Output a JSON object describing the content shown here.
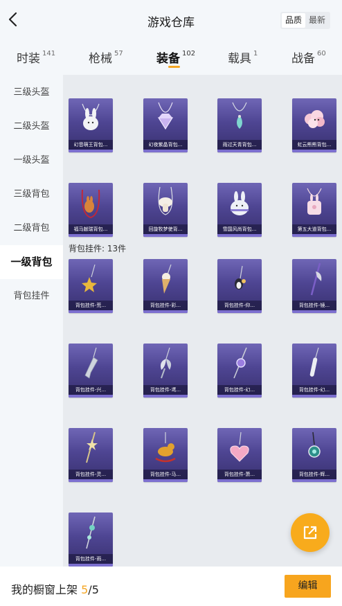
{
  "header": {
    "title": "游戏仓库",
    "sort": {
      "options": [
        "品质",
        "最新"
      ],
      "selected": "品质"
    }
  },
  "tabs": [
    {
      "label": "时装",
      "count": "141"
    },
    {
      "label": "枪械",
      "count": "57"
    },
    {
      "label": "装备",
      "count": "102",
      "active": true
    },
    {
      "label": "载具",
      "count": "1"
    },
    {
      "label": "战备",
      "count": "60"
    }
  ],
  "sidebar": {
    "items": [
      {
        "label": "三级头盔"
      },
      {
        "label": "二级头盔"
      },
      {
        "label": "一级头盔"
      },
      {
        "label": "三级背包"
      },
      {
        "label": "二级背包"
      },
      {
        "label": "一级背包",
        "active": true
      },
      {
        "label": "背包挂件"
      }
    ]
  },
  "content": {
    "backpacks": [
      {
        "name": "幻音萌王背包...",
        "icon": "white-bunny-backpack-icon"
      },
      {
        "name": "幻夜紫晶背包...",
        "icon": "purple-gem-backpack-icon"
      },
      {
        "name": "雨过天青背包...",
        "icon": "teal-drop-backpack-icon"
      },
      {
        "name": "虹云熊熊背包...",
        "icon": "pink-cloud-bear-backpack-icon"
      },
      {
        "name": "福马献瑞背包...",
        "icon": "red-horse-backpack-icon"
      },
      {
        "name": "回旋牧梦使背...",
        "icon": "mushroom-backpack-icon"
      },
      {
        "name": "雪国风尚背包...",
        "icon": "snow-bunny-backpack-icon"
      },
      {
        "name": "第五大道背包...",
        "icon": "pink-bunny-bag-icon"
      }
    ],
    "section_label": "背包挂件: 13件",
    "charms": [
      {
        "name": "背包挂件-荒...",
        "icon": "gold-star-charm-icon"
      },
      {
        "name": "背包挂件-彩...",
        "icon": "ice-cream-charm-icon"
      },
      {
        "name": "背包挂件-仰...",
        "icon": "penguin-charm-icon"
      },
      {
        "name": "背包挂件-镜...",
        "icon": "axe-charm-icon"
      },
      {
        "name": "背包挂件-兴...",
        "icon": "silver-gun-charm-icon"
      },
      {
        "name": "背包挂件-鸢...",
        "icon": "silver-fairy-charm-icon"
      },
      {
        "name": "背包挂件-幻...",
        "icon": "purple-orb-charm-icon"
      },
      {
        "name": "背包挂件-幻...",
        "icon": "bone-charm-icon"
      },
      {
        "name": "背包挂件-灵...",
        "icon": "gold-wand-charm-icon"
      },
      {
        "name": "背包挂件-马...",
        "icon": "rocking-horse-charm-icon"
      },
      {
        "name": "背包挂件-萧...",
        "icon": "pink-heart-charm-icon"
      },
      {
        "name": "背包挂件-辉...",
        "icon": "teal-locket-charm-icon"
      },
      {
        "name": "背包挂件-雨...",
        "icon": "teal-sword-charm-icon"
      }
    ]
  },
  "fab": {
    "icon": "share-external-icon"
  },
  "bottom": {
    "showcase_label": "我的橱窗上架",
    "showcase_current": "5",
    "showcase_sep": "/",
    "showcase_total": "5",
    "edit_label": "编辑"
  },
  "colors": {
    "accent": "#f5a623",
    "card_top": "#6f66b6",
    "card_bottom": "#38306f"
  }
}
